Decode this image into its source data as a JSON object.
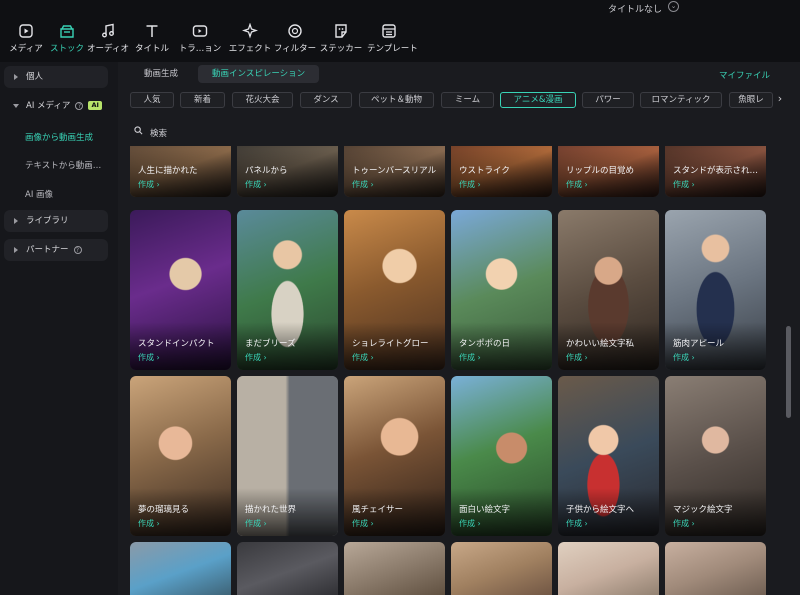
{
  "window": {
    "title": "タイトルなし"
  },
  "toolbar": {
    "items": [
      {
        "label": "メディア",
        "icon": "media-icon"
      },
      {
        "label": "ストック",
        "icon": "stock-icon"
      },
      {
        "label": "オーディオ",
        "icon": "music-note-icon"
      },
      {
        "label": "タイトル",
        "icon": "text-t-icon"
      },
      {
        "label": "トラ…ョン",
        "icon": "transition-icon"
      },
      {
        "label": "エフェクト",
        "icon": "sparkle-icon"
      },
      {
        "label": "フィルター",
        "icon": "filter-icon"
      },
      {
        "label": "ステッカー",
        "icon": "sticker-icon"
      },
      {
        "label": "テンプレート",
        "icon": "template-icon"
      }
    ],
    "active_index": 1,
    "accent": "#39d3b6"
  },
  "sidebar": {
    "personal": "個人",
    "ai_media": "AI メディア",
    "ai_badge": "AI",
    "sub_items": [
      "画像から動画生成",
      "テキストから動画…",
      "AI 画像"
    ],
    "library": "ライブラリ",
    "partner": "パートナー"
  },
  "subtabs": {
    "items": [
      "動画生成",
      "動画インスピレーション"
    ],
    "active_index": 1,
    "my_file": "マイファイル"
  },
  "categories": {
    "items": [
      "人気",
      "新着",
      "花火大会",
      "ダンス",
      "ペット＆動物",
      "ミーム",
      "アニメ&漫画",
      "パワー",
      "ロマンティック",
      "魚眼レ"
    ],
    "active_index": 6
  },
  "search": {
    "placeholder": "検索"
  },
  "cards": {
    "create_label": "作成 ›",
    "rows": [
      [
        "人生に描かれた",
        "パネルから",
        "トゥーンバースリアル",
        "ウストライク",
        "リップルの目覚め",
        "スタンドが表示され…"
      ],
      [
        "スタンドインパクト",
        "まだブリーズ",
        "ショレライトグロー",
        "タンポポの日",
        "かわいい絵文字私",
        "筋肉アピール"
      ],
      [
        "夢の瑠璃見る",
        "描かれた世界",
        "風チェイサー",
        "面白い絵文字",
        "子供から絵文字へ",
        "マジック絵文字"
      ],
      [
        "",
        "",
        "",
        "",
        "",
        ""
      ]
    ]
  }
}
